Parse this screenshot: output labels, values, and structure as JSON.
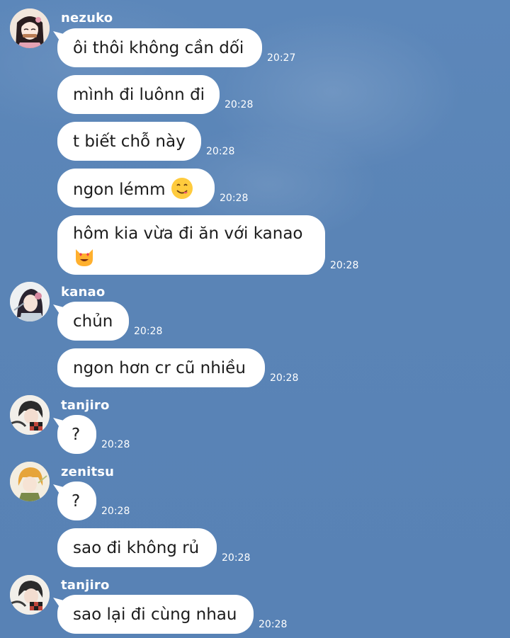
{
  "messages": [
    {
      "sender": "nezuko",
      "text": "ôi thôi không cần dối",
      "time": "20:27"
    },
    {
      "text": "mình đi luônn đi",
      "time": "20:28"
    },
    {
      "text": "t biết chỗ này",
      "time": "20:28"
    },
    {
      "text": "ngon lémm",
      "emoji": "yum-emoji",
      "time": "20:28"
    },
    {
      "text": "hôm kia vừa đi ăn với kanao",
      "emoji": "heart-eyes-cat-emoji",
      "time": "20:28"
    },
    {
      "sender": "kanao",
      "text": "chủn",
      "time": "20:28"
    },
    {
      "text": "ngon hơn cr cũ nhiều",
      "time": "20:28"
    },
    {
      "sender": "tanjiro",
      "text": "?",
      "time": "20:28"
    },
    {
      "sender": "zenitsu",
      "text": "?",
      "time": "20:28"
    },
    {
      "text": "sao đi không rủ",
      "time": "20:28"
    },
    {
      "sender": "tanjiro",
      "text": "sao lại đi cùng nhau",
      "time": "20:28"
    }
  ],
  "colors": {
    "background": "#5b85b8",
    "bubble": "#ffffff",
    "text": "#1c1c1c",
    "meta": "#ffffff"
  }
}
